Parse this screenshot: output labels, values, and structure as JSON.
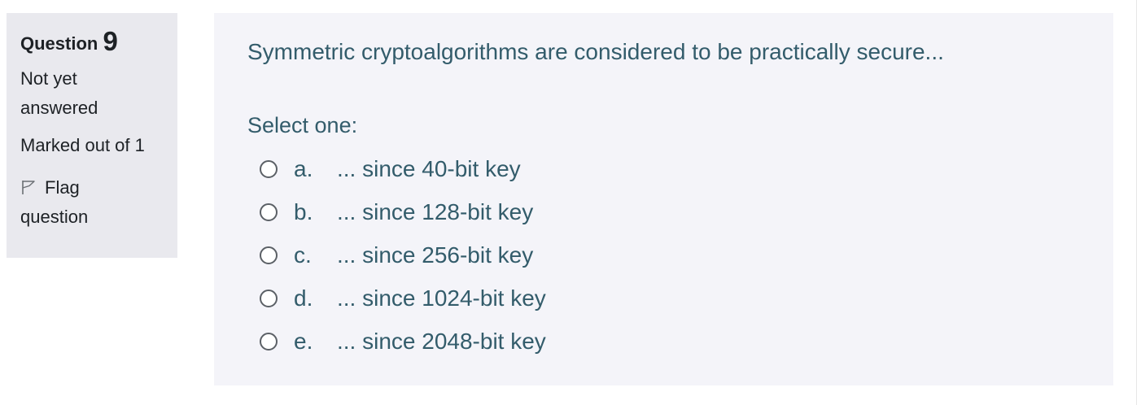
{
  "info": {
    "question_label": "Question",
    "question_number": "9",
    "state": "Not yet answered",
    "grade": "Marked out of 1",
    "flag_label": "Flag question",
    "flag_icon": "flag-outline-icon"
  },
  "question": {
    "text": "Symmetric cryptoalgorithms are considered to be practically secure...",
    "prompt": "Select one:",
    "options": [
      {
        "letter": "a.",
        "text": "... since 40-bit key"
      },
      {
        "letter": "b.",
        "text": "... since 128-bit key"
      },
      {
        "letter": "c.",
        "text": "... since 256-bit key"
      },
      {
        "letter": "d.",
        "text": "... since 1024-bit key"
      },
      {
        "letter": "e.",
        "text": "... since 2048-bit key"
      }
    ]
  },
  "colors": {
    "info_bg": "#e9e9ee",
    "content_bg": "#f4f4f9",
    "question_text": "#335c6b"
  }
}
